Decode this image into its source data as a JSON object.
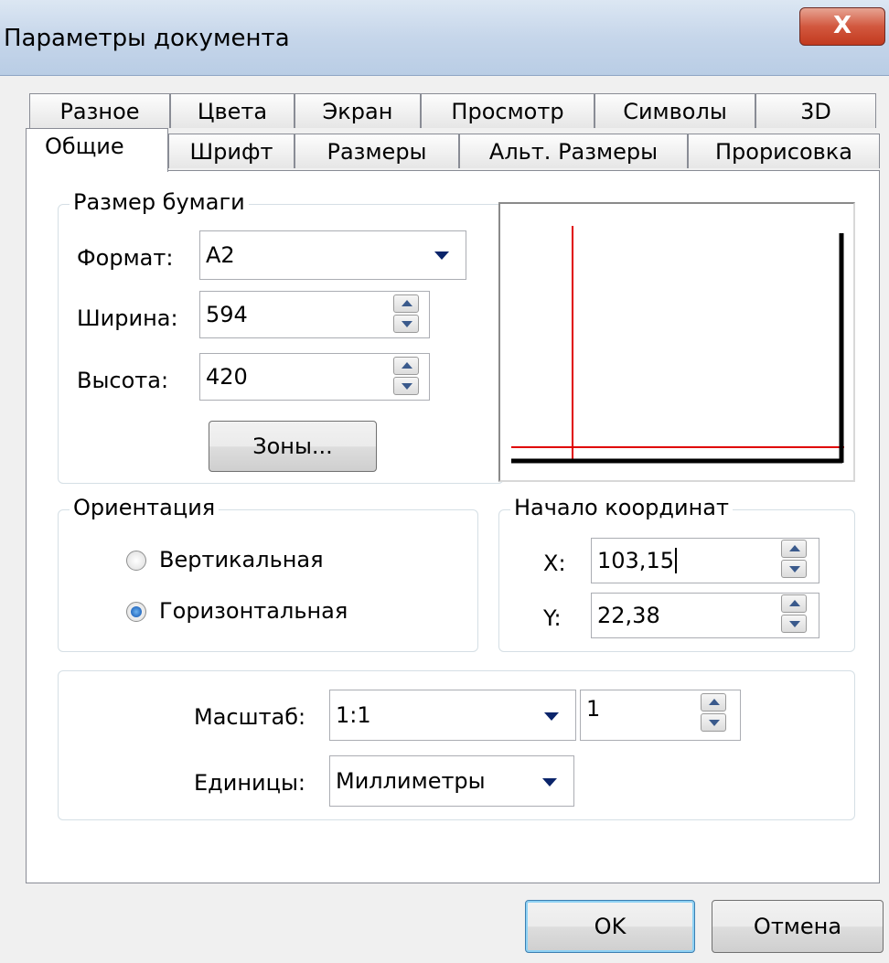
{
  "window": {
    "title": "Параметры документа",
    "close_glyph": "X"
  },
  "tabs": {
    "row_back": [
      "Разное",
      "Цвета",
      "Экран",
      "Просмотр",
      "Символы",
      "3D"
    ],
    "row_front": [
      "Общие",
      "Шрифт",
      "Размеры",
      "Альт. Размеры",
      "Прорисовка"
    ],
    "active": "Общие"
  },
  "paper": {
    "legend": "Размер бумаги",
    "format_label": "Формат:",
    "format_value": "A2",
    "width_label": "Ширина:",
    "width_value": "594",
    "height_label": "Высота:",
    "height_value": "420",
    "zones_button": "Зоны..."
  },
  "orientation": {
    "legend": "Ориентация",
    "vertical_label": "Вертикальная",
    "horizontal_label": "Горизонтальная",
    "selected": "horizontal"
  },
  "origin": {
    "legend": "Начало координат",
    "x_label": "X:",
    "x_value": "103,15",
    "y_label": "Y:",
    "y_value": "22,38"
  },
  "scale": {
    "scale_label": "Масштаб:",
    "scale_value": "1:1",
    "scale_factor": "1",
    "units_label": "Единицы:",
    "units_value": "Миллиметры"
  },
  "buttons": {
    "ok": "OK",
    "cancel": "Отмена"
  },
  "icons": [
    "close-icon",
    "dropdown-arrow-icon",
    "spin-up-icon",
    "spin-down-icon",
    "radio-icon"
  ],
  "colors": {
    "crosshair": "#e00000",
    "frame": "#000000",
    "titlebar": "#c6d6ea",
    "close": "#c23a1f"
  }
}
